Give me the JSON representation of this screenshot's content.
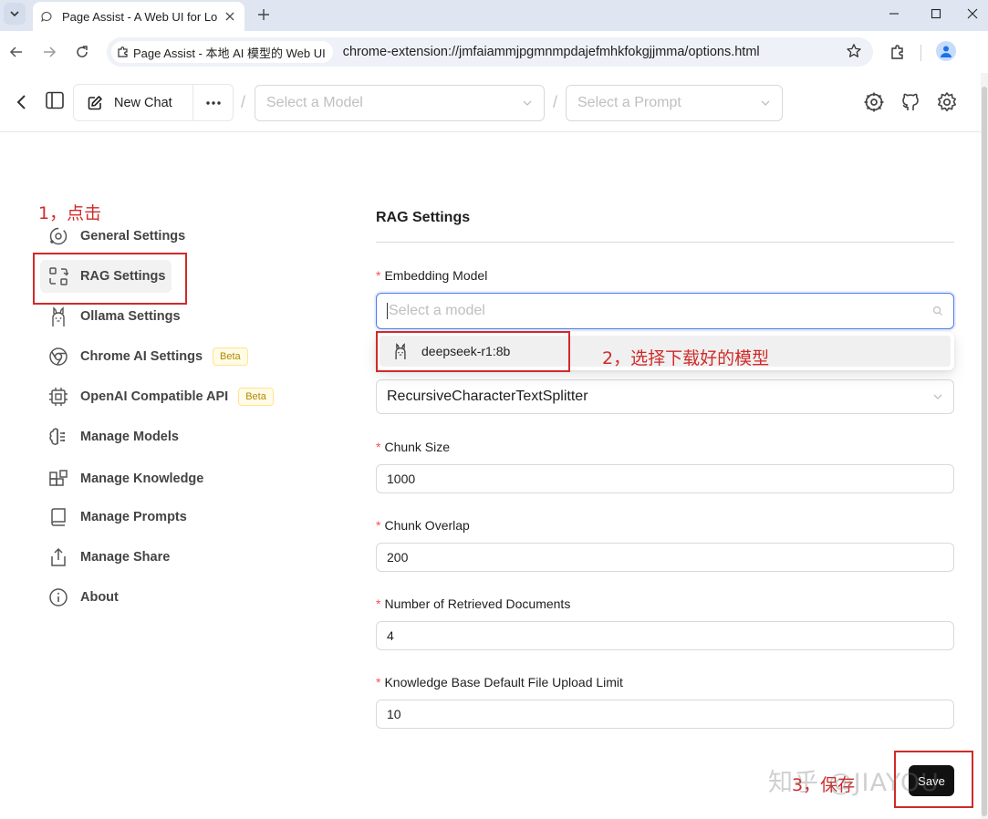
{
  "browser": {
    "tab_title": "Page Assist - A Web UI for Lo",
    "site_chip": "Page Assist - 本地 AI 模型的 Web UI",
    "url": "chrome-extension://jmfaiammjpgmnmpdajefmhkfokgjjmma/options.html"
  },
  "header": {
    "new_chat_label": "New Chat",
    "model_placeholder": "Select a Model",
    "prompt_placeholder": "Select a Prompt",
    "separator": "/"
  },
  "annotations": {
    "step1": "1，点击",
    "step2": "2，选择下载好的模型",
    "step3": "3，保存"
  },
  "sidebar": {
    "items": [
      {
        "label": "General Settings",
        "icon": "orbit-icon"
      },
      {
        "label": "RAG Settings",
        "icon": "rag-icon",
        "active": true
      },
      {
        "label": "Ollama Settings",
        "icon": "llama-icon"
      },
      {
        "label": "Chrome AI Settings",
        "icon": "chrome-icon",
        "badge": "Beta"
      },
      {
        "label": "OpenAI Compatible API",
        "icon": "chip-icon",
        "badge": "Beta"
      },
      {
        "label": "Manage Models",
        "icon": "brain-icon"
      },
      {
        "label": "Manage Knowledge",
        "icon": "blocks-icon"
      },
      {
        "label": "Manage Prompts",
        "icon": "book-icon"
      },
      {
        "label": "Manage Share",
        "icon": "share-icon"
      },
      {
        "label": "About",
        "icon": "info-icon"
      }
    ]
  },
  "rag": {
    "title": "RAG Settings",
    "embedding_model_label": "Embedding Model",
    "embedding_model_placeholder": "Select a model",
    "dropdown_option": "deepseek-r1:8b",
    "splitter_value": "RecursiveCharacterTextSplitter",
    "chunk_size_label": "Chunk Size",
    "chunk_size_value": "1000",
    "chunk_overlap_label": "Chunk Overlap",
    "chunk_overlap_value": "200",
    "retrieved_docs_label": "Number of Retrieved Documents",
    "retrieved_docs_value": "4",
    "upload_limit_label": "Knowledge Base Default File Upload Limit",
    "upload_limit_value": "10",
    "required_mark": "*",
    "save_label": "Save"
  },
  "watermark": "知乎 @JIAYOU"
}
